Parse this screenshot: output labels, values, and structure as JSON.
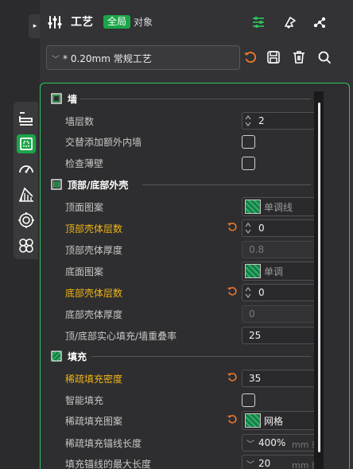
{
  "header": {
    "title": "工艺",
    "scope_global": "全局",
    "scope_object": "对象",
    "buttons": [
      "settings-list-icon",
      "compare-icon",
      "nodes-icon"
    ]
  },
  "preset": {
    "value": "* 0.20mm 常规工艺"
  },
  "side_tabs": [
    "quality",
    "strength",
    "speed",
    "support",
    "others",
    "multimaterial"
  ],
  "sections": {
    "wall": "墙",
    "top_bottom": "顶部/底部外壳",
    "infill": "填充"
  },
  "rows": {
    "wall_loops": {
      "label": "墙层数",
      "value": "2"
    },
    "alternate_extra_wall": {
      "label": "交替添加额外内墙"
    },
    "detect_thin_wall": {
      "label": "检查薄壁"
    },
    "top_pattern": {
      "label": "顶面图案",
      "value": "单调线"
    },
    "top_shell_layers": {
      "label": "顶部壳体层数",
      "value": "0"
    },
    "top_shell_thickness": {
      "label": "顶部壳体厚度",
      "value": "0.8"
    },
    "bottom_pattern": {
      "label": "底面图案",
      "value": "单调"
    },
    "bottom_shell_layers": {
      "label": "底部壳体层数",
      "value": "0"
    },
    "bottom_shell_thickness": {
      "label": "底部壳体厚度",
      "value": "0"
    },
    "infill_wall_overlap": {
      "label": "顶/底部实心填充/墙重叠率",
      "value": "25"
    },
    "sparse_infill_density": {
      "label": "稀疏填充密度",
      "value": "35"
    },
    "smart_infill": {
      "label": "智能填充"
    },
    "sparse_infill_pattern": {
      "label": "稀疏填充图案",
      "value": "网格"
    },
    "infill_anchor": {
      "label": "稀疏填充锚线长度",
      "value": "400%",
      "unit": "mm 或"
    },
    "infill_anchor_max": {
      "label": "填充锚线的最大长度",
      "value": "20",
      "unit": "mm 或"
    }
  },
  "colors": {
    "accent": "#1ba548",
    "modified_label": "#f2b515",
    "reset_icon": "#f07a2a"
  }
}
